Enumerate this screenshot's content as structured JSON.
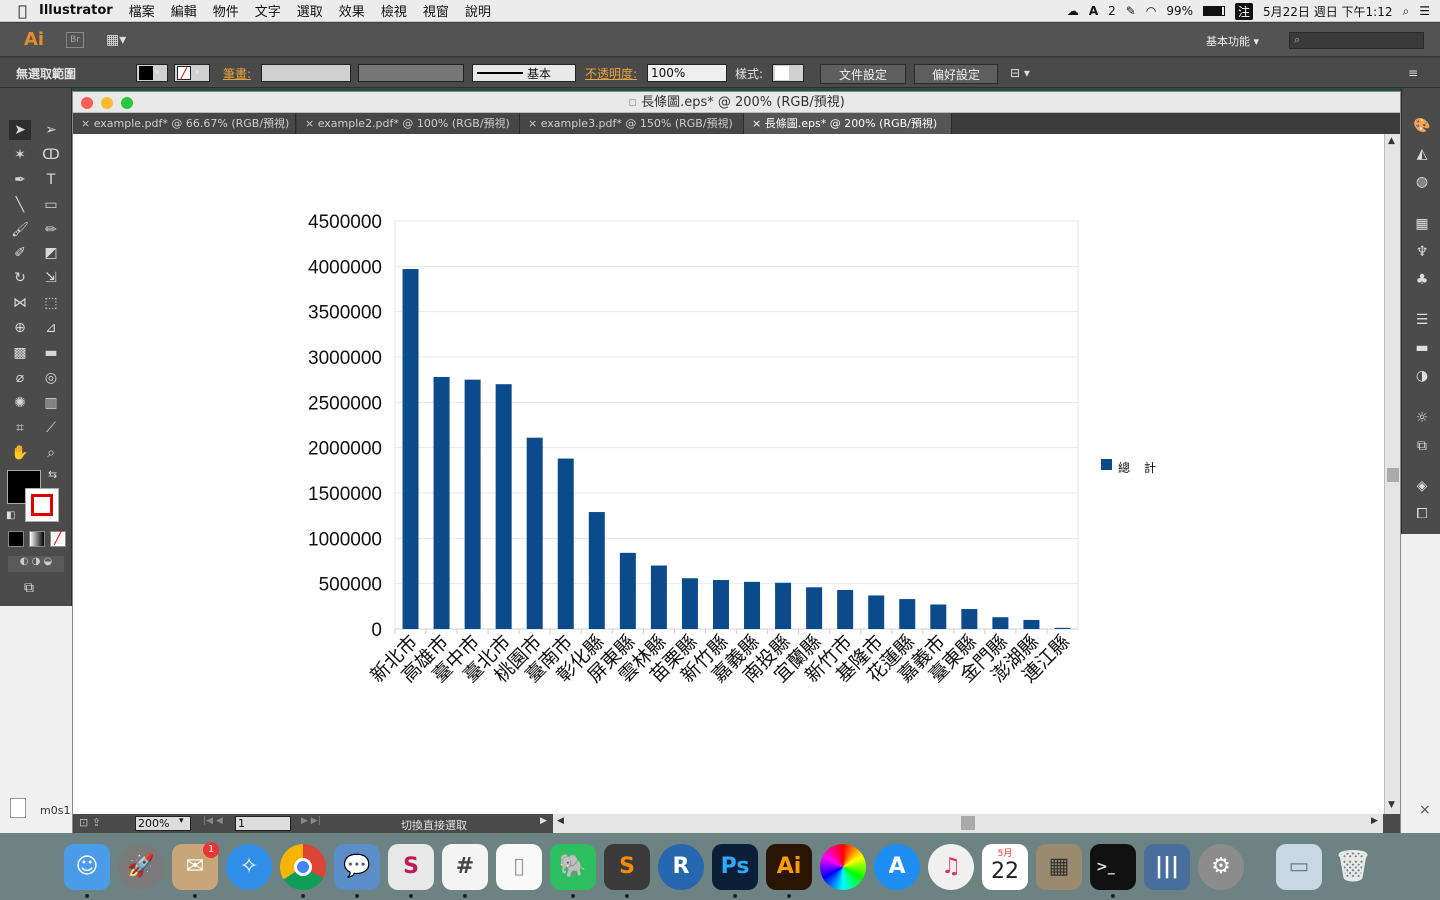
{
  "menubar": {
    "app": "Illustrator",
    "items": [
      "檔案",
      "編輯",
      "物件",
      "文字",
      "選取",
      "效果",
      "檢視",
      "視窗",
      "說明"
    ],
    "status_number": "2",
    "battery": "99%",
    "datetime": "5月22日 週日 下午1:12"
  },
  "appbar": {
    "logo": "Ai",
    "workspace": "基本功能"
  },
  "control": {
    "selection": "無選取範圍",
    "stroke_label": "筆畫:",
    "stroke_style": "基本",
    "opacity_label": "不透明度:",
    "opacity_value": "100%",
    "style_label": "樣式:",
    "doc_setup": "文件設定",
    "preferences": "偏好設定"
  },
  "document": {
    "title": "長條圖.eps* @ 200% (RGB/預視)",
    "tabs": [
      {
        "label": "example.pdf* @ 66.67% (RGB/預視)",
        "active": false
      },
      {
        "label": "example2.pdf* @ 100% (RGB/預視)",
        "active": false
      },
      {
        "label": "example3.pdf* @ 150% (RGB/預視)",
        "active": false
      },
      {
        "label": "長條圖.eps* @ 200% (RGB/預視)",
        "active": true
      }
    ],
    "zoom": "200%",
    "page": "1",
    "status_text": "切換直接選取"
  },
  "sidewin": {
    "label": "m0s1"
  },
  "chart_data": {
    "type": "bar",
    "categories": [
      "新北市",
      "高雄市",
      "臺中市",
      "臺北市",
      "桃園市",
      "臺南市",
      "彰化縣",
      "屏東縣",
      "雲林縣",
      "苗栗縣",
      "新竹縣",
      "嘉義縣",
      "南投縣",
      "宜蘭縣",
      "新竹市",
      "基隆市",
      "花蓮縣",
      "嘉義市",
      "臺東縣",
      "金門縣",
      "澎湖縣",
      "連江縣"
    ],
    "series": [
      {
        "name": "總計",
        "values": [
          3970000,
          2780000,
          2750000,
          2700000,
          2110000,
          1880000,
          1290000,
          840000,
          700000,
          560000,
          540000,
          520000,
          510000,
          460000,
          430000,
          370000,
          330000,
          270000,
          220000,
          130000,
          100000,
          13000
        ]
      }
    ],
    "yticks": [
      "0",
      "500000",
      "1000000",
      "1500000",
      "2000000",
      "2500000",
      "3000000",
      "3500000",
      "4000000",
      "4500000"
    ],
    "ylim": [
      0,
      4500000
    ],
    "legend_position": "right",
    "bar_color": "#0b4a8b"
  },
  "dock": {
    "calendar_month": "5月",
    "calendar_day": "22",
    "mail_badge": "1"
  }
}
